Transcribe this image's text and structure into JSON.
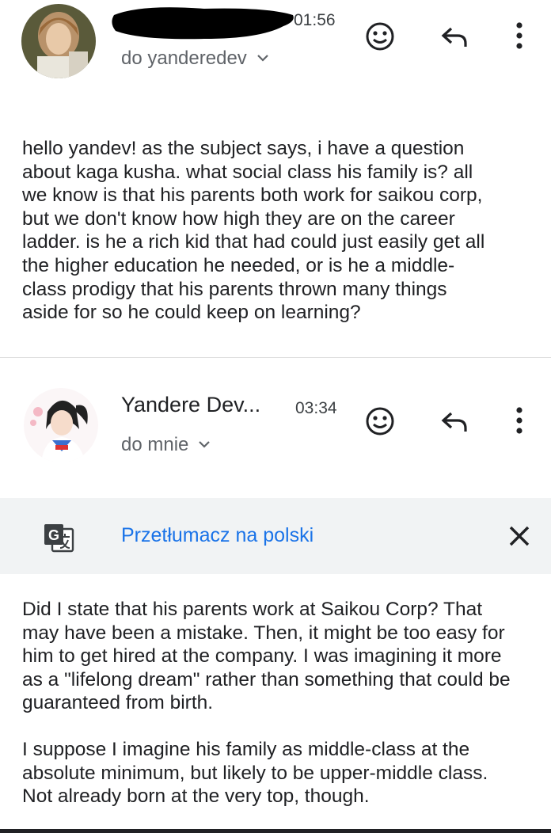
{
  "message1": {
    "sender_redacted": true,
    "time": "01:56",
    "recipient": "do yanderedev",
    "body_lines": [
      "hello yandev! as the subject says, i have a question",
      "about kaga kusha. what social class his family is? all",
      "we know is that his parents both work for saikou corp,",
      "but we don't know how high they are on the career",
      "ladder. is he a rich kid that had could just easily get all",
      "the higher education he needed, or is he a middle-",
      "class prodigy that his parents thrown many things",
      "aside for so he could keep on learning?"
    ]
  },
  "message2": {
    "sender": "Yandere Dev...",
    "time": "03:34",
    "recipient": "do mnie",
    "translate_label": "Przetłumacz na polski",
    "body_lines_p1": [
      "Did I state that his parents work at Saikou Corp? That",
      "may have been a mistake. Then, it might be too easy for",
      "him to get hired at the company. I was imagining it more",
      "as a \"lifelong dream\" rather than something that could be",
      "guaranteed from birth."
    ],
    "body_lines_p2": [
      "I suppose I imagine his family as middle-class at the",
      "absolute minimum, but likely to be upper-middle class.",
      "Not already born at the very top, though."
    ]
  },
  "icons": {
    "emoji": "emoji-reaction-icon",
    "reply": "reply-icon",
    "more": "more-vert-icon",
    "chevron": "chevron-down-icon",
    "translate": "translate-icon",
    "close": "close-icon"
  },
  "colors": {
    "link": "#1a73e8",
    "translate_bar": "#f1f3f4",
    "redaction": "#000000"
  }
}
